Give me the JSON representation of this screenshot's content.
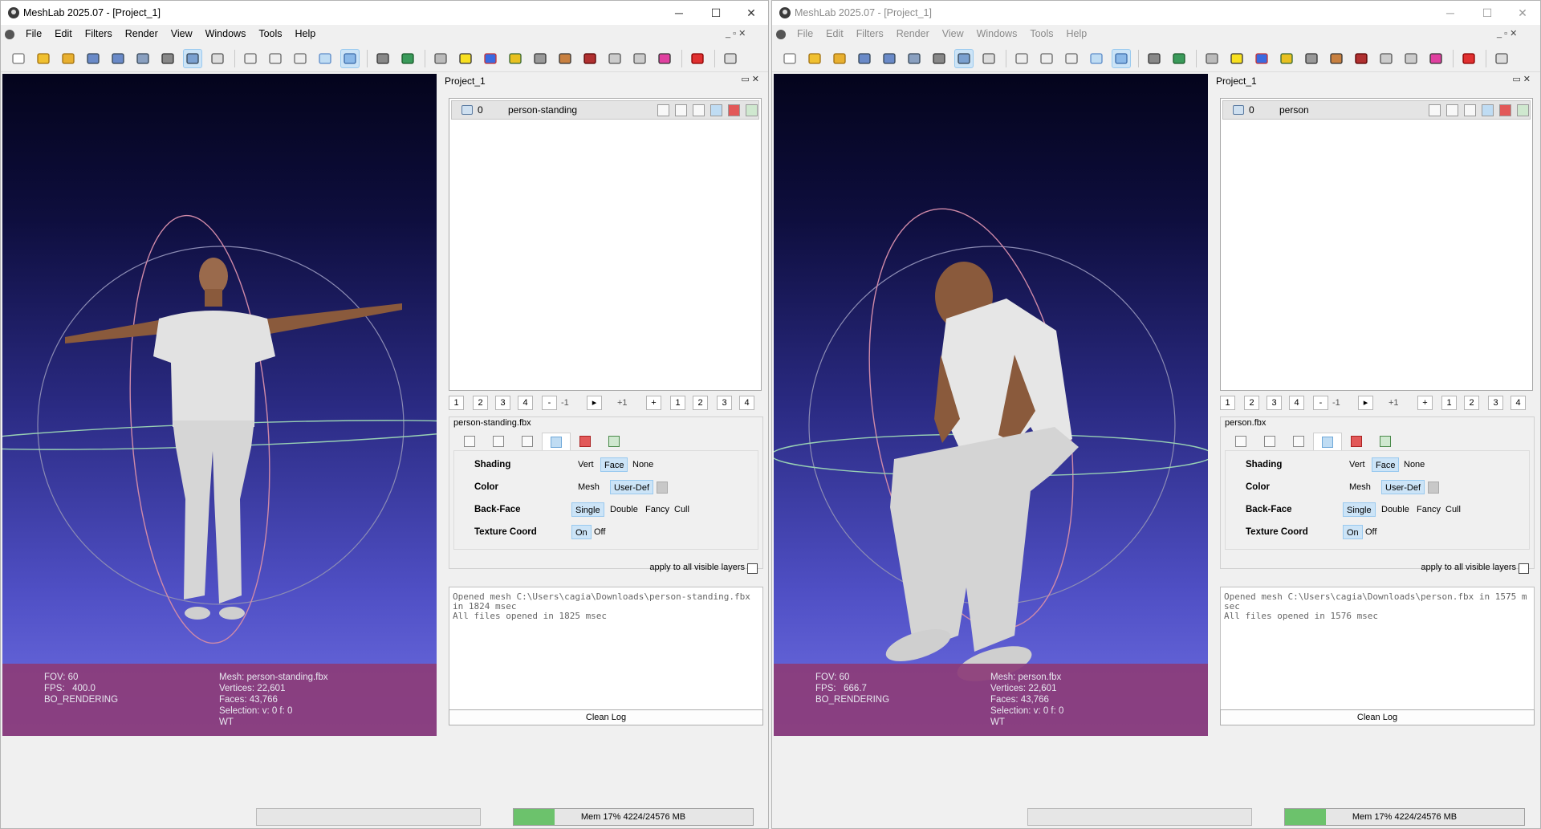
{
  "windows": [
    {
      "title": "MeshLab 2025.07 - [Project_1]",
      "menu": [
        "File",
        "Edit",
        "Filters",
        "Render",
        "View",
        "Windows",
        "Tools",
        "Help"
      ],
      "controls": {
        "minimize": "─",
        "maximize": "☐",
        "close": "✕"
      },
      "mdi_controls": "_ ▫ ✕",
      "project_title": "Project_1",
      "panel_btns": "▭ ✕",
      "layer": {
        "index": "0",
        "name": "person-standing"
      },
      "nav": [
        "1",
        "2",
        "3",
        "4",
        "-",
        "-1",
        "▸",
        "+1",
        "+",
        "1",
        "2",
        "3",
        "4"
      ],
      "decor_title": "person-standing.fbx",
      "props": {
        "shading": {
          "label": "Shading",
          "options": [
            "Vert",
            "Face",
            "None"
          ],
          "selected": "Face"
        },
        "color": {
          "label": "Color",
          "options": [
            "Mesh",
            "User-Def"
          ],
          "selected": "User-Def"
        },
        "backface": {
          "label": "Back-Face",
          "options": [
            "Single",
            "Double",
            "Fancy",
            "Cull"
          ],
          "selected": "Single"
        },
        "texcoord": {
          "label": "Texture Coord",
          "options": [
            "On",
            "Off"
          ],
          "selected": "On"
        }
      },
      "apply_all": "apply to all visible layers",
      "log": "Opened mesh C:\\Users\\cagia\\Downloads\\person-standing.fbx in 1824 msec\nAll files opened in 1825 msec",
      "clean_log": "Clean Log",
      "info_left": [
        "FOV: 60",
        "FPS:   400.0",
        "BO_RENDERING"
      ],
      "info_right": [
        "Mesh: person-standing.fbx",
        "Vertices: 22,601",
        "Faces: 43,766",
        "Selection: v: 0 f: 0",
        "WT"
      ],
      "mem": {
        "label": "Mem 17% 4224/24576 MB",
        "fraction": 0.17
      }
    },
    {
      "title": "MeshLab 2025.07 - [Project_1]",
      "menu": [
        "File",
        "Edit",
        "Filters",
        "Render",
        "View",
        "Windows",
        "Tools",
        "Help"
      ],
      "controls": {
        "minimize": "─",
        "maximize": "☐",
        "close": "✕"
      },
      "mdi_controls": "_ ▫ ✕",
      "project_title": "Project_1",
      "panel_btns": "▭ ✕",
      "layer": {
        "index": "0",
        "name": "person"
      },
      "nav": [
        "1",
        "2",
        "3",
        "4",
        "-",
        "-1",
        "▸",
        "+1",
        "+",
        "1",
        "2",
        "3",
        "4"
      ],
      "decor_title": "person.fbx",
      "props": {
        "shading": {
          "label": "Shading",
          "options": [
            "Vert",
            "Face",
            "None"
          ],
          "selected": "Face"
        },
        "color": {
          "label": "Color",
          "options": [
            "Mesh",
            "User-Def"
          ],
          "selected": "User-Def"
        },
        "backface": {
          "label": "Back-Face",
          "options": [
            "Single",
            "Double",
            "Fancy",
            "Cull"
          ],
          "selected": "Single"
        },
        "texcoord": {
          "label": "Texture Coord",
          "options": [
            "On",
            "Off"
          ],
          "selected": "On"
        }
      },
      "apply_all": "apply to all visible layers",
      "log": "Opened mesh C:\\Users\\cagia\\Downloads\\person.fbx in 1575 msec\nAll files opened in 1576 msec",
      "clean_log": "Clean Log",
      "info_left": [
        "FOV: 60",
        "FPS:   666.7",
        "BO_RENDERING"
      ],
      "info_right": [
        "Mesh: person.fbx",
        "Vertices: 22,601",
        "Faces: 43,766",
        "Selection: v: 0 f: 0",
        "WT"
      ],
      "mem": {
        "label": "Mem 17% 4224/24576 MB",
        "fraction": 0.17
      }
    }
  ],
  "colors": {
    "selected_bg": "#cce4f7",
    "info_bg": "#8c3c78",
    "mem_fill": "#6cc26c"
  }
}
